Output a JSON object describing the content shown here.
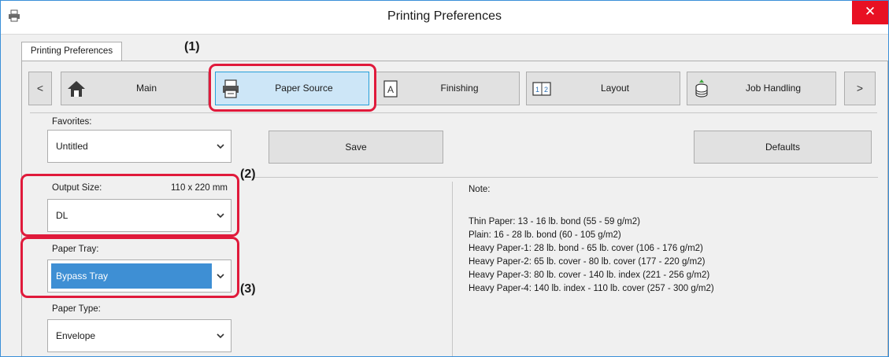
{
  "window": {
    "title": "Printing Preferences",
    "close_glyph": "✕"
  },
  "outer_tab": "Printing Preferences",
  "nav": {
    "prev_glyph": "<",
    "next_glyph": ">",
    "tabs": [
      {
        "label": "Main",
        "icon": "home-icon"
      },
      {
        "label": "Paper Source",
        "icon": "printer-paper-icon",
        "active": true
      },
      {
        "label": "Finishing",
        "icon": "finishing-icon"
      },
      {
        "label": "Layout",
        "icon": "layout-icon"
      },
      {
        "label": "Job Handling",
        "icon": "job-handling-icon"
      }
    ]
  },
  "favorites": {
    "label": "Favorites:",
    "value": "Untitled",
    "save": "Save",
    "defaults": "Defaults"
  },
  "output_size": {
    "label": "Output Size:",
    "dimension": "110 x 220 mm",
    "value": "DL"
  },
  "paper_tray": {
    "label": "Paper Tray:",
    "value": "Bypass Tray"
  },
  "paper_type": {
    "label": "Paper Type:",
    "value": "Envelope"
  },
  "note": {
    "title": "Note:",
    "lines": [
      "Thin Paper: 13 - 16 lb. bond (55 - 59 g/m2)",
      "Plain: 16 - 28 lb. bond (60 - 105 g/m2)",
      "Heavy Paper-1: 28 lb. bond - 65 lb. cover (106 - 176 g/m2)",
      "Heavy Paper-2: 65 lb. cover - 80 lb. cover (177 - 220 g/m2)",
      "Heavy Paper-3: 80 lb. cover - 140 lb. index (221 - 256 g/m2)",
      "Heavy Paper-4: 140 lb. index - 110 lb. cover (257 - 300 g/m2)"
    ]
  },
  "callouts": {
    "one": "(1)",
    "two": "(2)",
    "three": "(3)"
  },
  "colors": {
    "accent_red": "#e01a3b",
    "selection_blue": "#3e8fd4",
    "close_red": "#e81123"
  }
}
